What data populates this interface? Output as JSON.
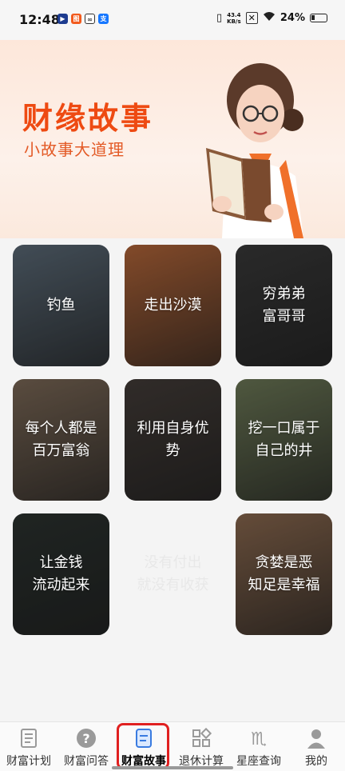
{
  "status_bar": {
    "time": "12:48",
    "net_speed_value": "43.4",
    "net_speed_unit": "KB/s",
    "battery": "24%"
  },
  "banner": {
    "title": "财缘故事",
    "subtitle": "小故事大道理"
  },
  "stories": [
    {
      "label": "钓鱼",
      "color": "#5c6b78"
    },
    {
      "label": "走出沙漠",
      "color": "#b5673a"
    },
    {
      "label": "穷弟弟\n富哥哥",
      "color": "#3a3a3a"
    },
    {
      "label": "每个人都是\n百万富翁",
      "color": "#7d6a58"
    },
    {
      "label": "利用自身优\n势",
      "color": "#443d39"
    },
    {
      "label": "挖一口属于\n自己的井",
      "color": "#6e7a58"
    },
    {
      "label": "让金钱\n流动起来",
      "color": "#2c3330"
    },
    {
      "label": "没有付出\n就没有收获",
      "color": "#f4f4f4"
    },
    {
      "label": "贪婪是恶\n知足是幸福",
      "color": "#8c6a50"
    }
  ],
  "tabs": [
    {
      "label": "财富计划",
      "icon": "plan-icon"
    },
    {
      "label": "财富问答",
      "icon": "question-icon"
    },
    {
      "label": "财富故事",
      "icon": "story-icon",
      "active": true
    },
    {
      "label": "退休计算",
      "icon": "grid-icon"
    },
    {
      "label": "星座查询",
      "icon": "zodiac-icon"
    },
    {
      "label": "我的",
      "icon": "profile-icon"
    }
  ]
}
